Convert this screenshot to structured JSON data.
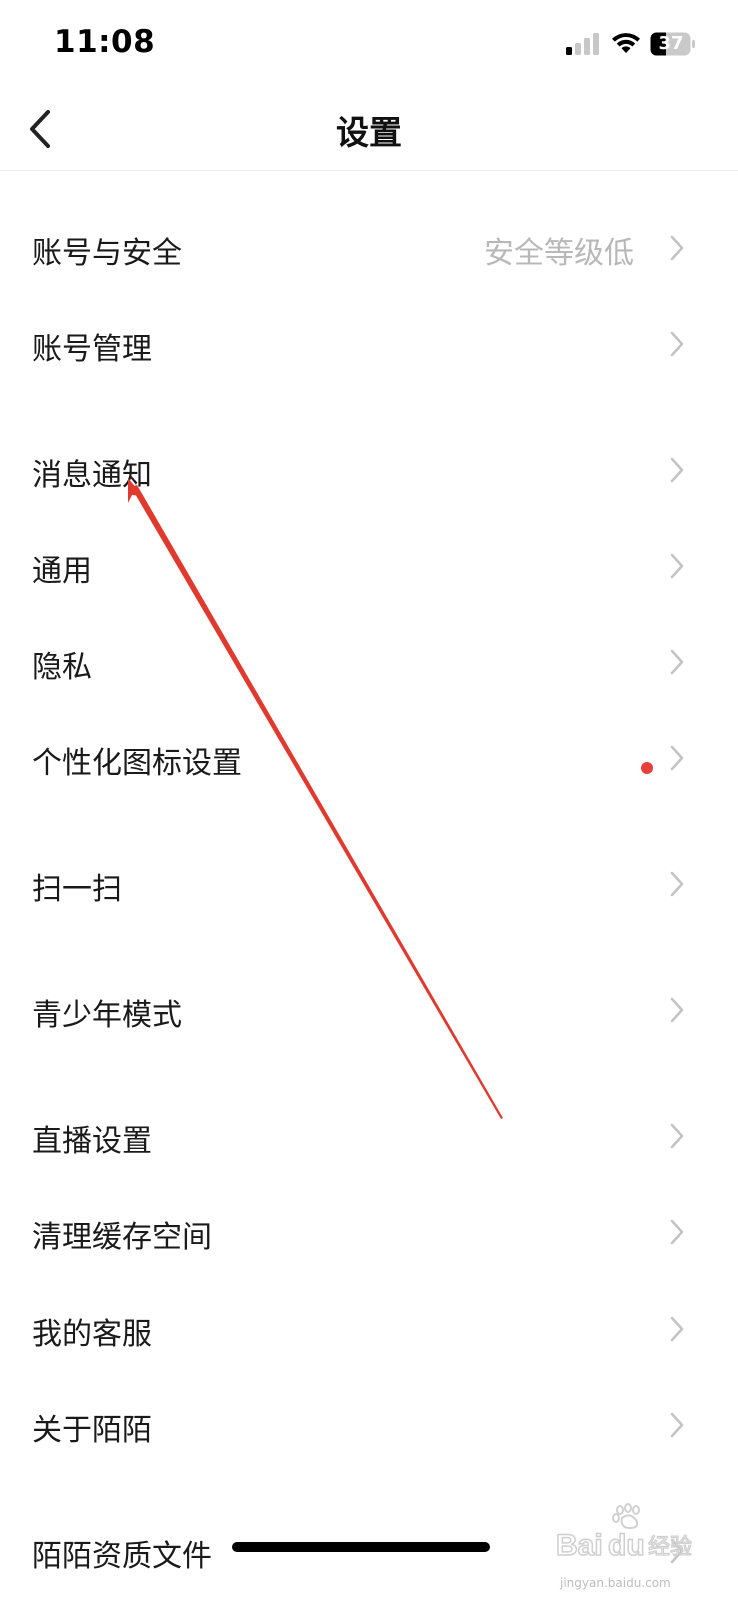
{
  "status_bar": {
    "time": "11:08",
    "battery_level": "37",
    "signal_icon": "signal-icon",
    "wifi_icon": "wifi-icon",
    "battery_icon": "battery-icon"
  },
  "nav": {
    "title": "设置",
    "back_icon": "chevron-left-icon"
  },
  "settings": [
    {
      "label": "账号与安全",
      "value": "安全等级低"
    },
    {
      "label": "账号管理"
    },
    {
      "label": "消息通知"
    },
    {
      "label": "通用"
    },
    {
      "label": "隐私"
    },
    {
      "label": "个性化图标设置",
      "badge": "red-dot"
    },
    {
      "label": "扫一扫"
    },
    {
      "label": "青少年模式"
    },
    {
      "label": "直播设置"
    },
    {
      "label": "清理缓存空间"
    },
    {
      "label": "我的客服"
    },
    {
      "label": "关于陌陌"
    },
    {
      "label": "陌陌资质文件"
    }
  ],
  "colors": {
    "arrow": "#e03a2f",
    "badge": "#e5403a",
    "secondary_text": "#b8b8b8",
    "chevron": "#c4c4c4"
  },
  "watermark": {
    "brand": "Bai",
    "suffix": "经验",
    "url": "jingyan.baidu.com"
  }
}
